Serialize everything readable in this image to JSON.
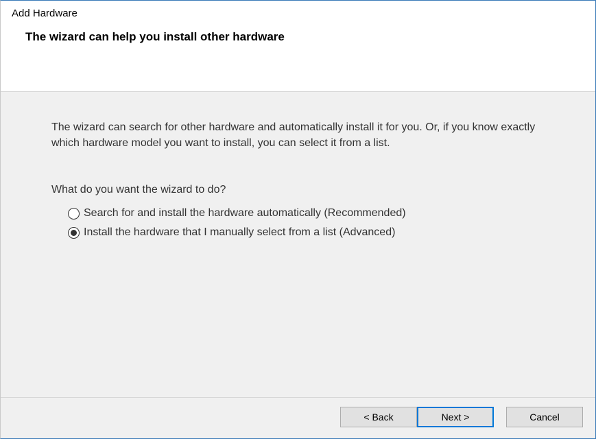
{
  "window": {
    "title": "Add Hardware",
    "subtitle": "The wizard can help you install other hardware"
  },
  "content": {
    "description": "The wizard can search for other hardware and automatically install it for you. Or, if you know exactly which hardware model you want to install, you can select it from a list.",
    "prompt": "What do you want the wizard to do?",
    "options": [
      {
        "label": "Search for and install the hardware automatically (Recommended)",
        "selected": false
      },
      {
        "label": "Install the hardware that I manually select from a list (Advanced)",
        "selected": true
      }
    ]
  },
  "footer": {
    "back": "< Back",
    "next": "Next >",
    "cancel": "Cancel"
  }
}
